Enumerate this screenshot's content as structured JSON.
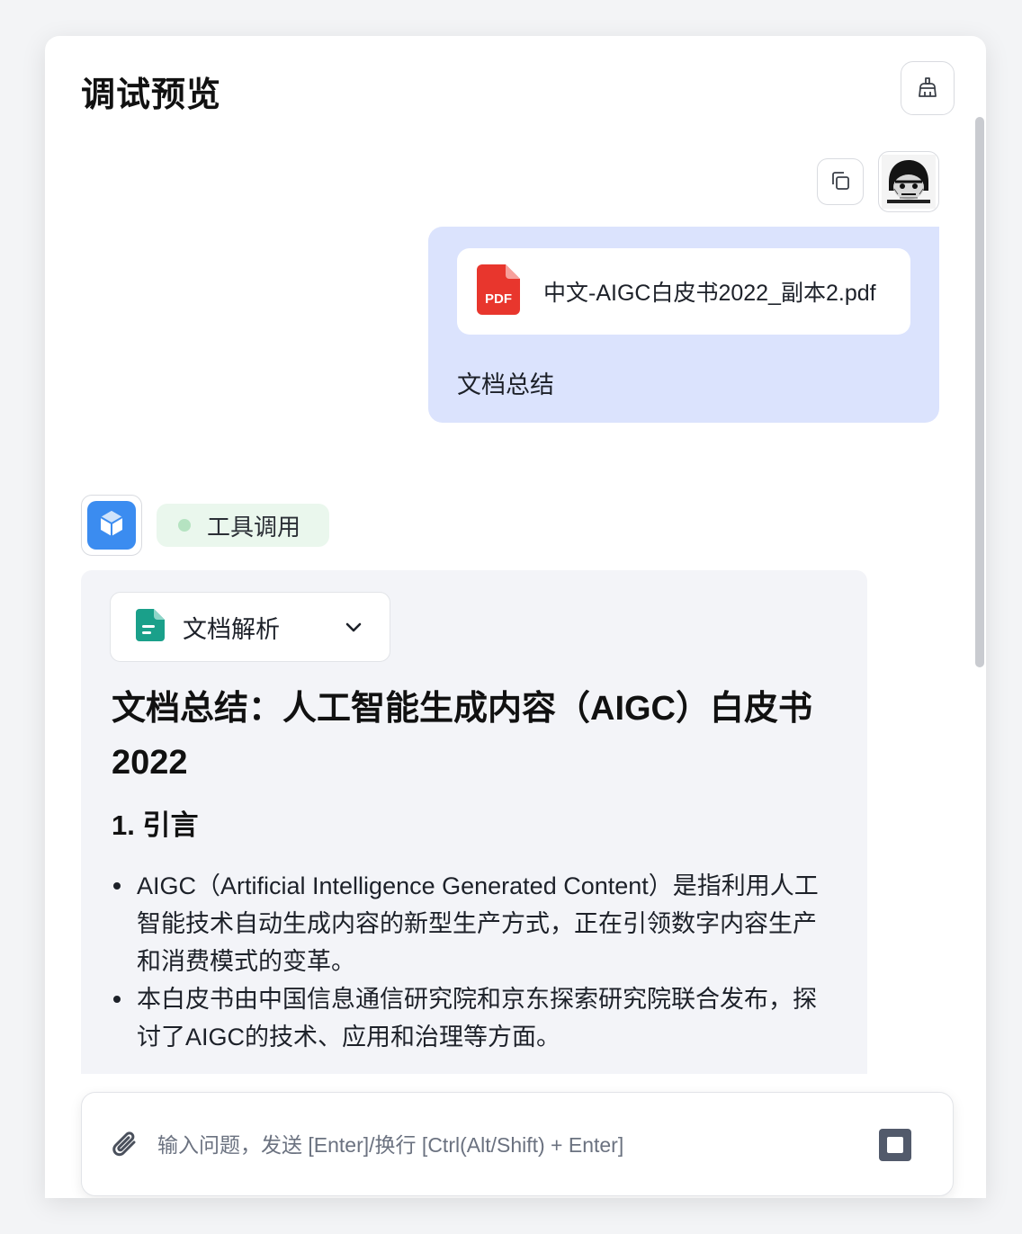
{
  "header": {
    "title": "调试预览",
    "clear_icon": "broom-icon"
  },
  "user_message": {
    "copy_icon": "copy-icon",
    "file": {
      "icon": "pdf-file-icon",
      "icon_text": "PDF",
      "name": "中文-AIGC白皮书2022_副本2.pdf"
    },
    "text": "文档总结"
  },
  "bot_message": {
    "avatar_icon": "cube-icon",
    "tool_badge": "工具调用",
    "tool_chip": {
      "icon": "document-icon",
      "label": "文档解析",
      "chevron": "chevron-down-icon"
    },
    "heading": "文档总结：人工智能生成内容（AIGC）白皮书2022",
    "section_title": "1. 引言",
    "bullets": [
      "AIGC（Artificial Intelligence Generated Content）是指利用人工智能技术自动生成内容的新型生产方式，正在引领数字内容生产和消费模式的变革。",
      "本白皮书由中国信息通信研究院和京东探索研究院联合发布，探讨了AIGC的技术、应用和治理等方面。"
    ]
  },
  "composer": {
    "placeholder": "输入问题，发送 [Enter]/换行 [Ctrl(Alt/Shift) + Enter]",
    "value": "",
    "attach_icon": "paperclip-icon",
    "stop_icon": "stop-icon"
  },
  "colors": {
    "user_bubble": "#dbe3fd",
    "bot_card": "#f3f4f8",
    "tool_badge_bg": "#eaf7ed",
    "tool_dot": "#b5e3c1",
    "pdf_red": "#e8362d",
    "doc_teal": "#1aa08a",
    "avatar_blue": "#3b8cf0"
  }
}
